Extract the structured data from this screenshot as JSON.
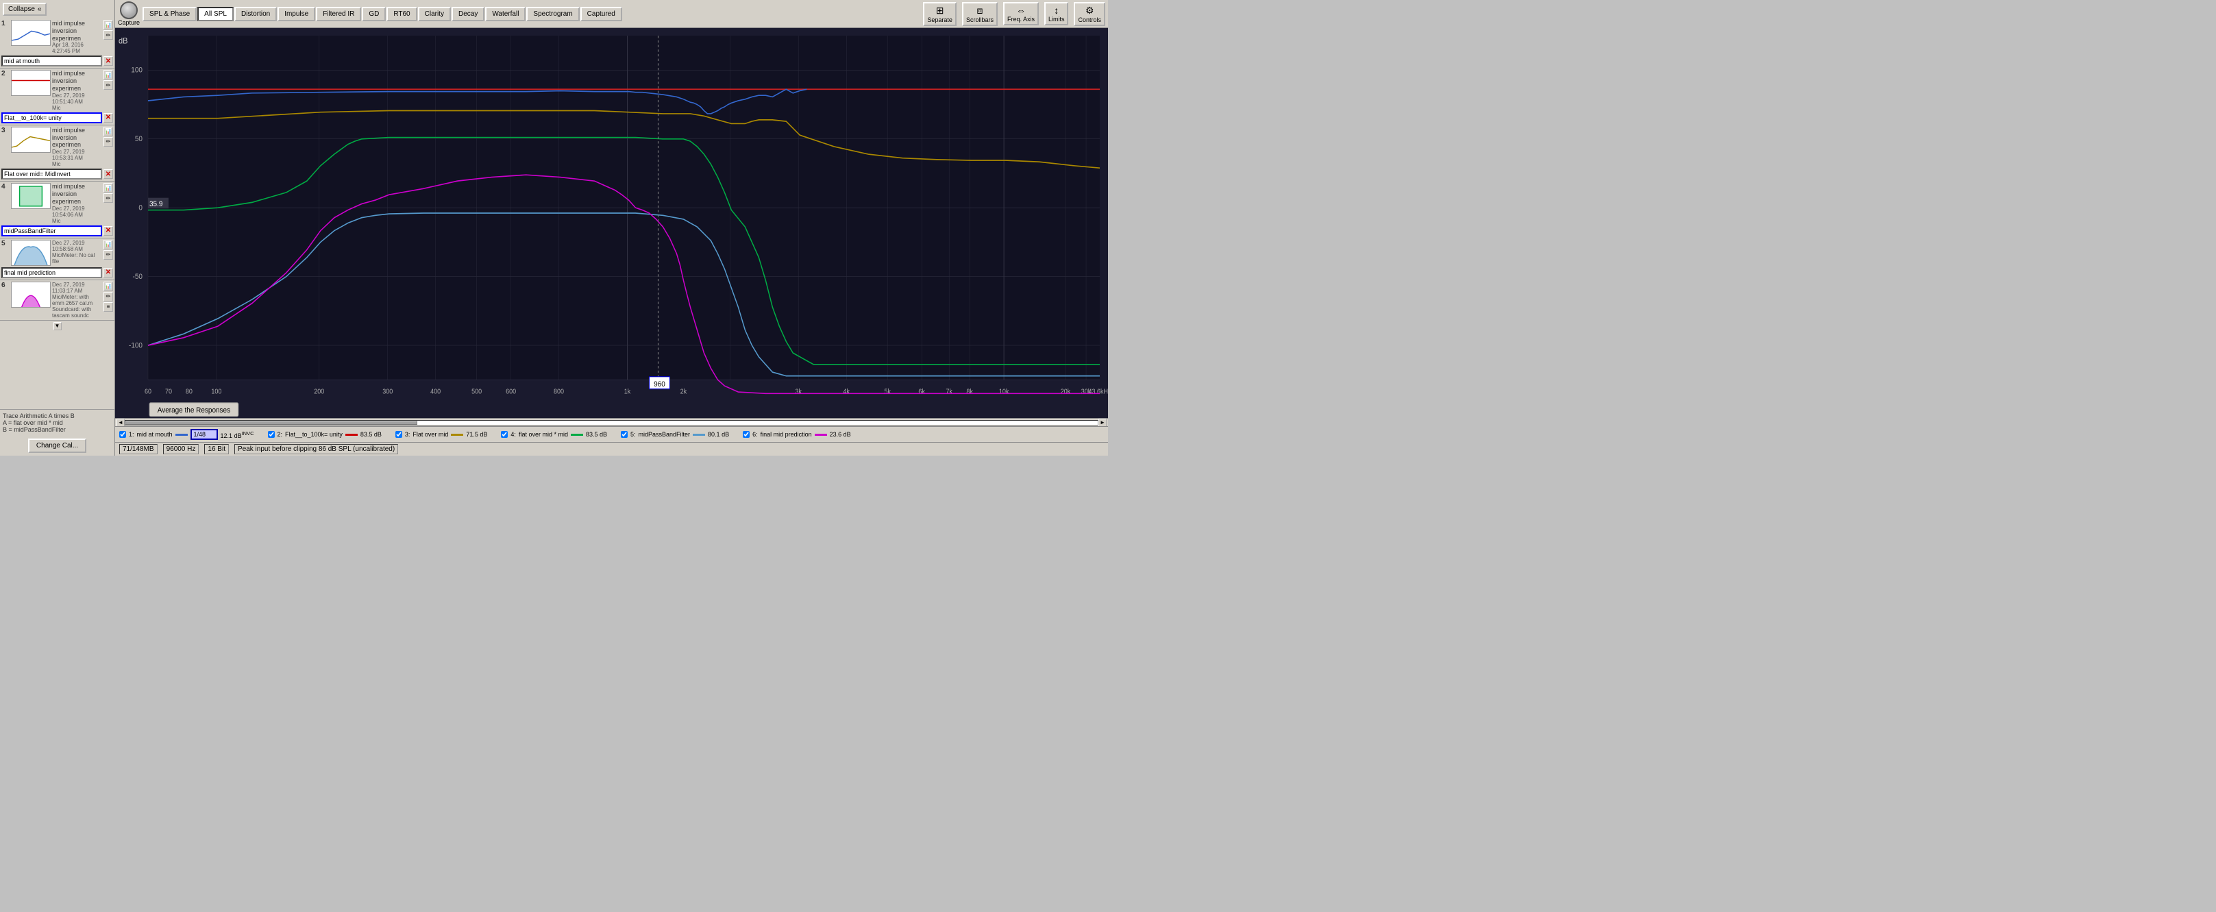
{
  "sidebar": {
    "collapse_label": "Collapse",
    "items": [
      {
        "num": "1",
        "title": "mid impulse inversion experimen",
        "date": "Apr 18, 2016 4:27:45 PM",
        "sub": "",
        "name": "mid at mouth",
        "name_active": false
      },
      {
        "num": "2",
        "title": "mid impulse inversion experimen",
        "date": "Dec 27, 2019 10:51:40 AM",
        "sub": "Mic",
        "name": "Flat__to_100k= unity",
        "name_active": true
      },
      {
        "num": "3",
        "title": "mid impulse inversion experimen",
        "date": "Dec 27, 2019 10:53:31 AM",
        "sub": "Mic",
        "name": "Flat over mid= MidInvert",
        "name_active": false
      },
      {
        "num": "4",
        "title": "mid impulse inversion experimen",
        "date": "Dec 27, 2019 10:54:06 AM",
        "sub": "Mic",
        "name": "midPassBandFilter",
        "name_active": true
      },
      {
        "num": "5",
        "title": "",
        "date": "Dec 27, 2019 10:58:58 AM",
        "sub": "Mic/Meter: No cal file",
        "name": "final mid prediction",
        "name_active": false
      },
      {
        "num": "6",
        "title": "",
        "date": "Dec 27, 2019 11:03:17 AM",
        "sub": "Mic/Meter: with emm 2657 cal.m",
        "sub2": "Soundcard: with tascam soundc",
        "name": "",
        "name_active": false
      }
    ],
    "trace_info": "Trace Arithmetic A times B\nA = flat over mid * mid\nB = midPassBandFilter",
    "change_cal_label": "Change Cal..."
  },
  "toolbar": {
    "capture_label": "Capture",
    "tabs": [
      {
        "label": "SPL & Phase",
        "active": false
      },
      {
        "label": "All SPL",
        "active": true
      },
      {
        "label": "Distortion",
        "active": false
      },
      {
        "label": "Impulse",
        "active": false
      },
      {
        "label": "Filtered IR",
        "active": false
      },
      {
        "label": "GD",
        "active": false
      },
      {
        "label": "RT60",
        "active": false
      },
      {
        "label": "Clarity",
        "active": false
      },
      {
        "label": "Decay",
        "active": false
      },
      {
        "label": "Waterfall",
        "active": false
      },
      {
        "label": "Spectrogram",
        "active": false
      },
      {
        "label": "Captured",
        "active": false
      }
    ],
    "right_buttons": [
      {
        "label": "Separate",
        "icon": "⊞"
      },
      {
        "label": "Scrollbars",
        "icon": "⧈"
      },
      {
        "label": "Freq. Axis",
        "icon": "⇔"
      },
      {
        "label": "Limits",
        "icon": "↕"
      },
      {
        "label": "Controls",
        "icon": "⚙"
      }
    ]
  },
  "chart": {
    "y_title": "dB",
    "y_labels": [
      "100",
      "50",
      "0",
      "-50",
      "-100"
    ],
    "x_labels": [
      "60",
      "70",
      "80",
      "100",
      "200",
      "300",
      "400",
      "500",
      "600",
      "800",
      "1k",
      "2k",
      "3k",
      "4k",
      "5k",
      "6k",
      "7k",
      "8k",
      "10k",
      "20k",
      "30k",
      "43.6kHz"
    ],
    "marker_value": "35.9",
    "cursor_freq": "960",
    "avg_button": "Average the Responses"
  },
  "legend": {
    "items": [
      {
        "num": "1",
        "label": "mid at mouth",
        "filter": "1/48",
        "value": "12.1 dB",
        "value_sup": "INVC",
        "color": "#3366cc",
        "checked": true
      },
      {
        "num": "2",
        "label": "Flat__to_100k= unity",
        "value": "83.5 dB",
        "color": "#cc0000",
        "checked": true
      },
      {
        "num": "3",
        "label": "Flat over mid",
        "value": "71.5 dB",
        "color": "#aa8800",
        "checked": true
      },
      {
        "num": "4",
        "label": "flat over mid * mid",
        "value": "83.5 dB",
        "color": "#00aa44",
        "checked": true
      },
      {
        "num": "5",
        "label": "midPassBandFilter",
        "value": "80.1 dB",
        "color": "#5599cc",
        "checked": true
      },
      {
        "num": "6",
        "label": "final mid prediction",
        "value": "23.6 dB",
        "color": "#cc00cc",
        "checked": true
      }
    ]
  },
  "status": {
    "memory": "71/148MB",
    "sample_rate": "96000 Hz",
    "bit_depth": "16 Bit",
    "peak_info": "Peak input before clipping 86 dB SPL (uncalibrated)"
  }
}
